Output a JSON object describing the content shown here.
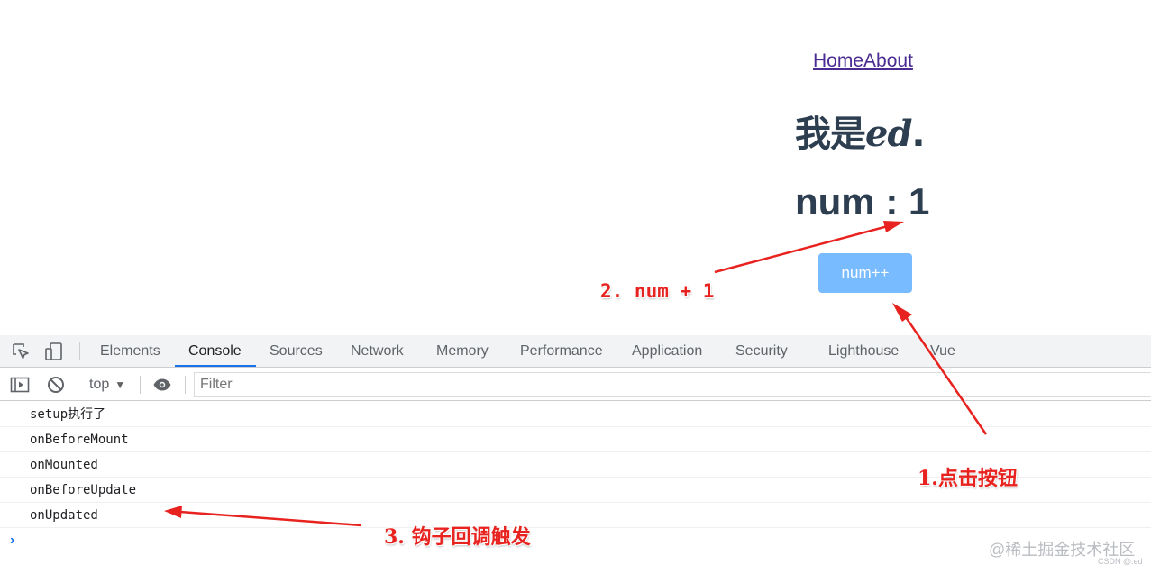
{
  "app": {
    "nav": {
      "home": "Home",
      "about": "About"
    },
    "title_prefix": "我是",
    "title_italic": "ed",
    "title_suffix": ".",
    "num_text": "num : 1",
    "button_label": "num++"
  },
  "devtools": {
    "tabs": [
      "Elements",
      "Console",
      "Sources",
      "Network",
      "Memory",
      "Performance",
      "Application",
      "Security",
      "Lighthouse",
      "Vue"
    ],
    "active_tab": "Console",
    "context": "top",
    "filter_placeholder": "Filter",
    "logs": [
      "setup执行了",
      "onBeforeMount",
      "onMounted",
      "onBeforeUpdate",
      "onUpdated"
    ],
    "prompt": "›",
    "accent_color": "#1a73e8"
  },
  "annotations": {
    "step1": "1.点击按钮",
    "step2": "2. num + 1",
    "step3": "3. 钩子回调触发",
    "color": "#e8231f"
  },
  "watermark": {
    "main": "@稀土掘金技术社区",
    "sub": "CSDN @.ed"
  },
  "colors": {
    "button": "#79bbff",
    "heading": "#2c3e50",
    "link": "#4b2c92"
  }
}
